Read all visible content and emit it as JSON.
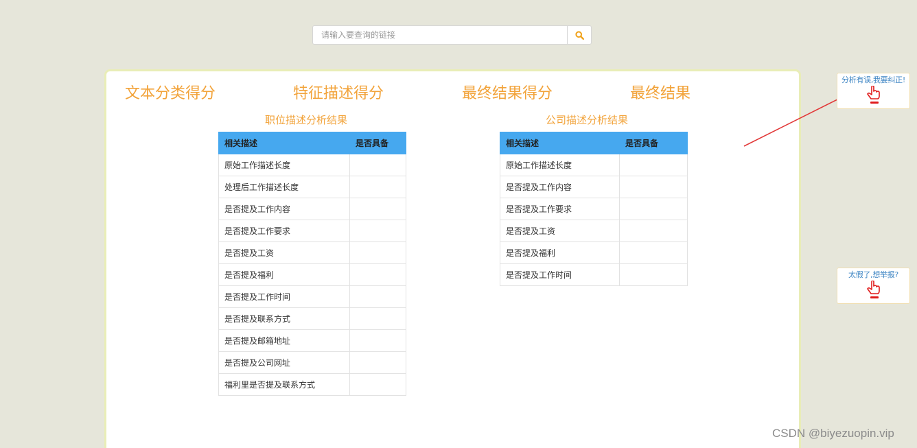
{
  "search": {
    "placeholder": "请输入要查询的链接",
    "button_icon": "search-icon"
  },
  "scores": {
    "text_classification": "文本分类得分",
    "feature_description": "特征描述得分",
    "final_result_score": "最终结果得分",
    "final_result": "最终结果"
  },
  "job_table": {
    "title": "职位描述分析结果",
    "headers": [
      "相关描述",
      "是否具备"
    ],
    "rows": [
      "原始工作描述长度",
      "处理后工作描述长度",
      "是否提及工作内容",
      "是否提及工作要求",
      "是否提及工资",
      "是否提及福利",
      "是否提及工作时间",
      "是否提及联系方式",
      "是否提及邮箱地址",
      "是否提及公司网址",
      "福利里是否提及联系方式"
    ]
  },
  "company_table": {
    "title": "公司描述分析结果",
    "headers": [
      "相关描述",
      "是否具备"
    ],
    "rows": [
      "原始工作描述长度",
      "是否提及工作内容",
      "是否提及工作要求",
      "是否提及工资",
      "是否提及福利",
      "是否提及工作时间"
    ]
  },
  "side": {
    "correct_label": "分析有误,我要纠正!",
    "report_label": "太假了,想举报?",
    "icon": "pointing-hand-icon"
  },
  "watermark": "CSDN @biyezuopin.vip",
  "colors": {
    "background": "#e6e6da",
    "accent_orange": "#f2a33a",
    "table_header": "#46a8ef",
    "link_blue": "#3f86c4",
    "hand_red": "#e01b1b",
    "arrow_red": "#e23a3a"
  }
}
